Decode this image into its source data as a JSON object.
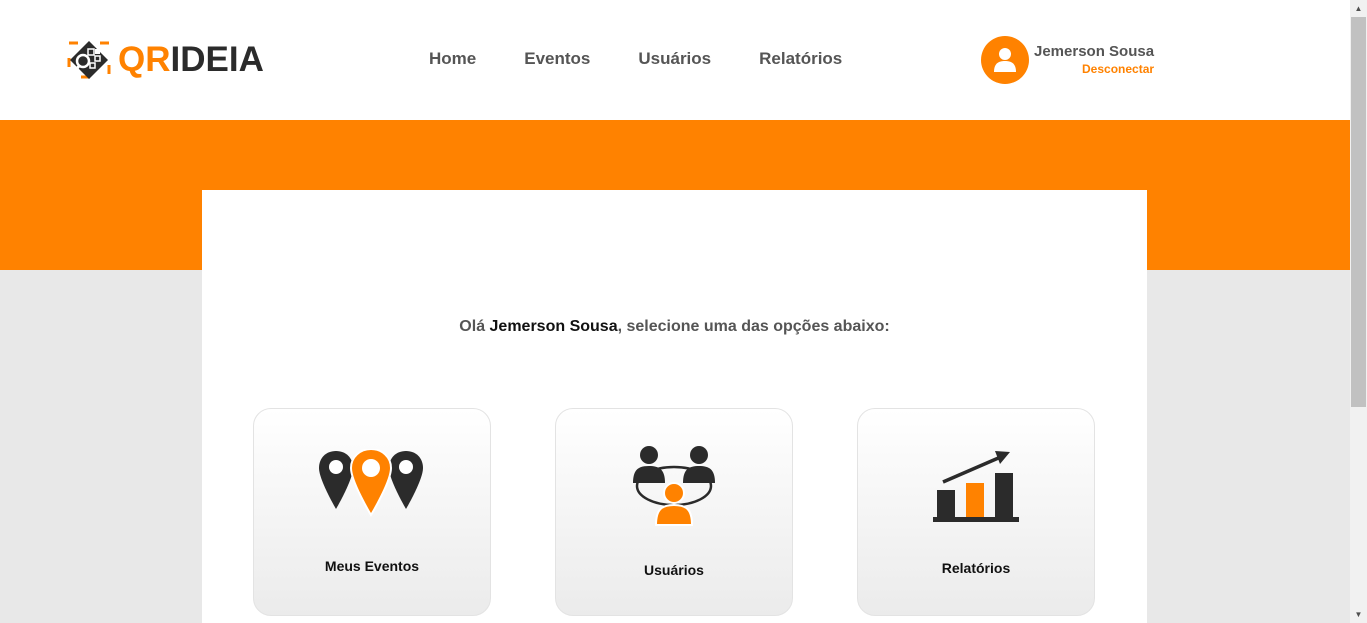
{
  "brand": {
    "logo_qr": "QR",
    "logo_ideia": "IDEIA",
    "accent_color": "#ff8200",
    "dark_color": "#2b2b2b"
  },
  "nav": {
    "items": [
      {
        "label": "Home"
      },
      {
        "label": "Eventos"
      },
      {
        "label": "Usuários"
      },
      {
        "label": "Relatórios"
      }
    ]
  },
  "user": {
    "name": "Jemerson Sousa",
    "logout_label": "Desconectar",
    "avatar_icon": "user-icon"
  },
  "greeting": {
    "prefix": "Olá ",
    "name": "Jemerson Sousa",
    "suffix": ", selecione uma das opções abaixo:"
  },
  "cards": [
    {
      "label": "Meus Eventos",
      "icon": "map-pins-icon"
    },
    {
      "label": "Usuários",
      "icon": "users-network-icon"
    },
    {
      "label": "Relatórios",
      "icon": "bar-chart-growth-icon"
    }
  ],
  "scrollbar": {
    "up_arrow": "▲",
    "down_arrow": "▼"
  }
}
